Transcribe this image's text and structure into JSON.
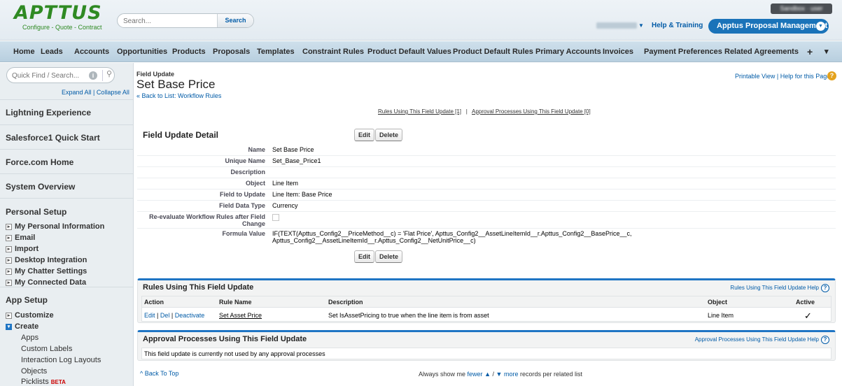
{
  "header": {
    "logo_main": "APTTUS",
    "logo_sub": "Configure - Quote - Contract",
    "search_placeholder": "Search...",
    "search_button": "Search",
    "help_training": "Help & Training",
    "app_menu": "Apptus Proposal Management",
    "sandbox_badge": "Sandbox · user"
  },
  "tabs": [
    "Home",
    "Leads",
    "Accounts",
    "Opportunities",
    "Products",
    "Proposals",
    "Templates",
    "Constraint Rules",
    "Product Default Values",
    "Product Default Rules",
    "Primary Accounts",
    "Invoices",
    "Payment Preferences",
    "Related Agreements",
    "+",
    "▾"
  ],
  "sidebar": {
    "quick_find_placeholder": "Quick Find / Search...",
    "expand_collapse": "Expand All | Collapse All",
    "sections": [
      "Lightning Experience",
      "Salesforce1 Quick Start",
      "Force.com Home",
      "System Overview"
    ],
    "personal_setup": {
      "title": "Personal Setup",
      "items": [
        "My Personal Information",
        "Email",
        "Import",
        "Desktop Integration",
        "My Chatter Settings",
        "My Connected Data"
      ]
    },
    "app_setup": {
      "title": "App Setup",
      "items": [
        "Customize",
        "Create"
      ],
      "create_children": [
        "Apps",
        "Custom Labels",
        "Interaction Log Layouts",
        "Objects",
        "Picklists"
      ],
      "beta": "BETA"
    }
  },
  "main": {
    "object_type": "Field Update",
    "title": "Set Base Price",
    "back_link": "« Back to List: Workflow Rules",
    "printable": "Printable View | Help for this Page",
    "quick_links": {
      "rules": "Rules Using This Field Update [1]",
      "sep": "|",
      "approvals": "Approval Processes Using This Field Update [0]"
    },
    "detail": {
      "title": "Field Update Detail",
      "edit": "Edit",
      "delete": "Delete",
      "fields": [
        {
          "label": "Name",
          "value": "Set Base Price"
        },
        {
          "label": "Unique Name",
          "value": "Set_Base_Price1"
        },
        {
          "label": "Description",
          "value": ""
        },
        {
          "label": "Object",
          "value": "Line Item"
        },
        {
          "label": "Field to Update",
          "value": "Line Item: Base Price"
        },
        {
          "label": "Field Data Type",
          "value": "Currency"
        },
        {
          "label": "Re-evaluate Workflow Rules after Field Change",
          "value": ""
        },
        {
          "label": "Formula Value",
          "value": "IF(TEXT(Apttus_Config2__PriceMethod__c) = 'Flat Price', Apttus_Config2__AssetLineItemId__r.Apttus_Config2__BasePrice__c, Apttus_Config2__AssetLineItemId__r.Apttus_Config2__NetUnitPrice__c)"
        }
      ],
      "re_evaluate_checked": false
    },
    "rules": {
      "title": "Rules Using This Field Update",
      "help": "Rules Using This Field Update Help",
      "columns": [
        "Action",
        "Rule Name",
        "Description",
        "Object",
        "Active"
      ],
      "rows": [
        {
          "action_edit": "Edit",
          "action_del": "Del",
          "action_deactivate": "Deactivate",
          "rule_name": "Set Asset Price",
          "description": "Set IsAssetPricing to true when the line item is from asset",
          "object": "Line Item",
          "active": "✓"
        }
      ]
    },
    "approvals": {
      "title": "Approval Processes Using This Field Update",
      "help": "Approval Processes Using This Field Update Help",
      "empty_text": "This field update is currently not used by any approval processes"
    },
    "footer": {
      "back_to_top": "Back To Top",
      "show_prefix": "Always show me",
      "fewer": "fewer",
      "more": "more",
      "show_suffix": "records per related list"
    }
  }
}
